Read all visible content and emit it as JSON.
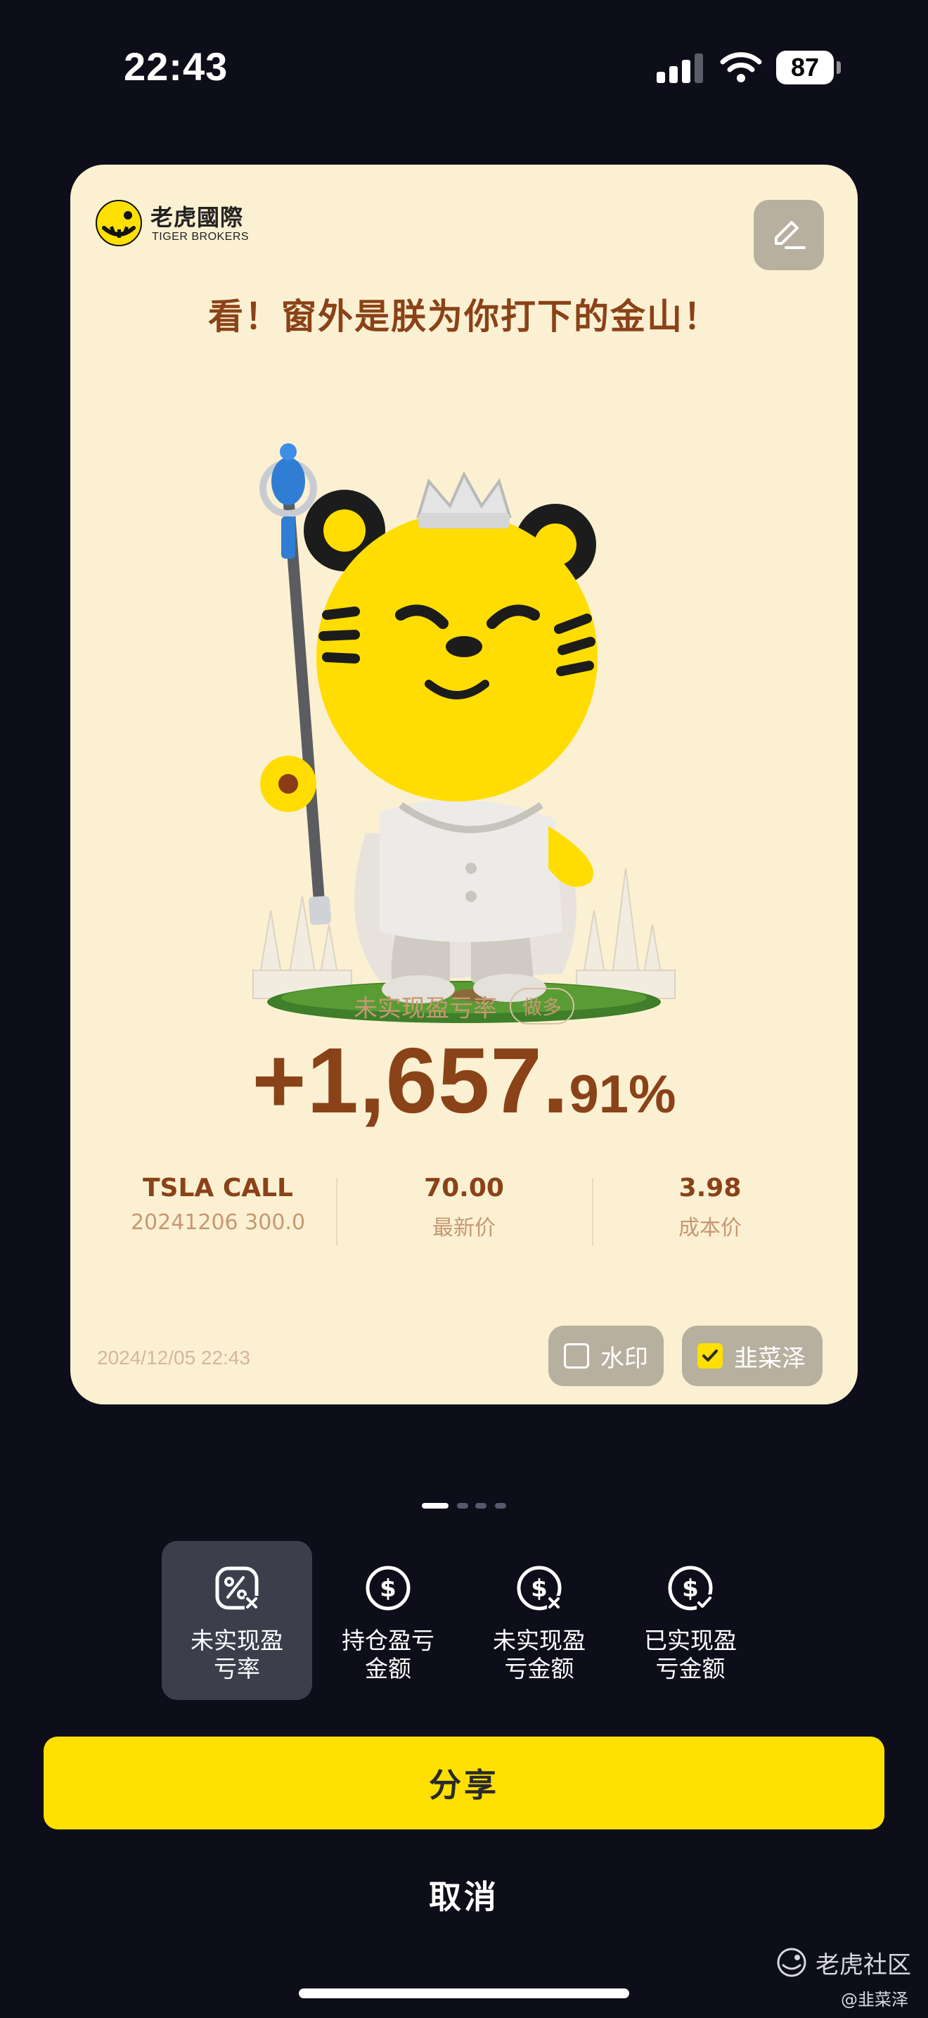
{
  "status_bar": {
    "time": "22:43",
    "battery": "87"
  },
  "card": {
    "brand_cn": "老虎國際",
    "brand_en": "TIGER BROKERS",
    "headline": "看！窗外是朕为你打下的金山！",
    "metric_label": "未实现盈亏率",
    "direction_tag": "做多",
    "value_main": "+1,657.",
    "value_fraction": "91%",
    "stats": [
      {
        "top": "TSLA CALL",
        "bottom": "20241206  300.0"
      },
      {
        "top": "70.00",
        "bottom": "最新价"
      },
      {
        "top": "3.98",
        "bottom": "成本价"
      }
    ],
    "timestamp": "2024/12/05 22:43",
    "watermark_toggle": {
      "label": "水印",
      "checked": false
    },
    "nickname_toggle": {
      "label": "韭菜泽",
      "checked": true
    }
  },
  "pager": {
    "total": 4,
    "active": 0
  },
  "options": [
    {
      "label": "未实现盈\n亏率",
      "icon": "percent-icon",
      "selected": true
    },
    {
      "label": "持仓盈亏\n金额",
      "icon": "dollar-icon",
      "selected": false
    },
    {
      "label": "未实现盈\n亏金额",
      "icon": "dollar-x-icon",
      "selected": false
    },
    {
      "label": "已实现盈\n亏金额",
      "icon": "dollar-check-icon",
      "selected": false
    }
  ],
  "buttons": {
    "share": "分享",
    "cancel": "取消"
  },
  "watermark": {
    "community": "老虎社区",
    "user": "@韭菜泽"
  },
  "colors": {
    "accent": "#FFE000",
    "card_bg": "#FCF0D2",
    "headline": "#8A4218",
    "background": "#0D0E19"
  }
}
